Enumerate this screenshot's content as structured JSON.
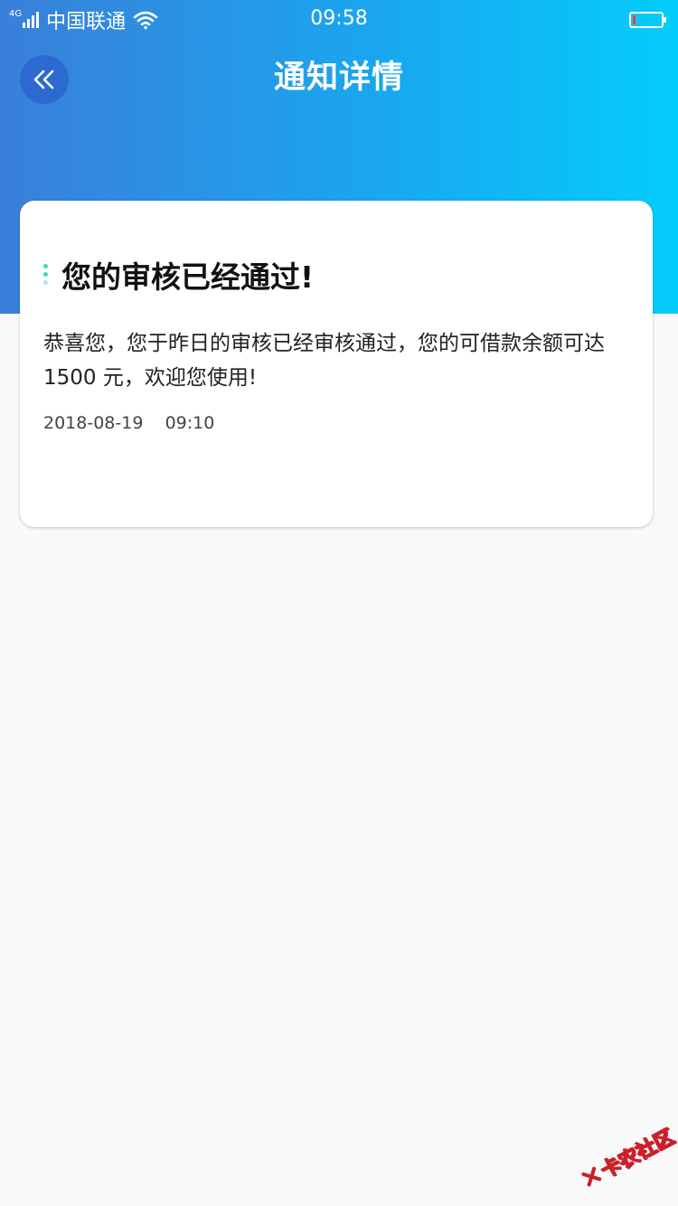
{
  "status_bar": {
    "network": "4G",
    "carrier": "中国联通",
    "time": "09:58"
  },
  "nav": {
    "title": "通知详情",
    "back_icon": "double-chevron-left-icon"
  },
  "notification": {
    "title": "您的审核已经通过!",
    "body": "恭喜您，您于昨日的审核已经审核通过，您的可借款余额可达 1500 元，欢迎您使用!",
    "date": "2018-08-19",
    "time": "09:10"
  },
  "watermark": {
    "text": "卡农社区"
  },
  "colors": {
    "header_gradient_start": "#3a7fd9",
    "header_gradient_end": "#04cdfb",
    "back_button": "#2d6ad0",
    "title_accent_dots": "#3fd9c2",
    "page_background": "#f9f9f9"
  }
}
